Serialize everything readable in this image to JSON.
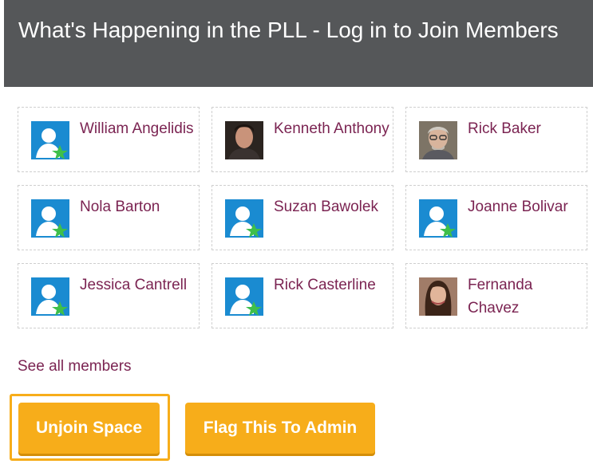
{
  "header": {
    "title": "What's Happening in the PLL - Log in to Join Members"
  },
  "members": [
    {
      "name": "William Angelidis",
      "avatar": "default-user-icon"
    },
    {
      "name": "Kenneth Anthony",
      "avatar": "photo"
    },
    {
      "name": "Rick Baker",
      "avatar": "photo"
    },
    {
      "name": "Nola Barton",
      "avatar": "default-user-icon"
    },
    {
      "name": "Suzan Bawolek",
      "avatar": "default-user-icon"
    },
    {
      "name": "Joanne Bolivar",
      "avatar": "default-user-icon"
    },
    {
      "name": "Jessica Cantrell",
      "avatar": "default-user-icon"
    },
    {
      "name": "Rick Casterline",
      "avatar": "default-user-icon"
    },
    {
      "name": "Fernanda Chavez",
      "avatar": "photo"
    }
  ],
  "see_all_label": "See all members",
  "actions": {
    "unjoin_label": "Unjoin Space",
    "flag_label": "Flag This To Admin"
  },
  "colors": {
    "header_bg": "#555759",
    "link": "#7b2452",
    "button": "#f7ad1a",
    "default_avatar_bg": "#1a8bd1",
    "default_avatar_star": "#3fbf4a"
  }
}
